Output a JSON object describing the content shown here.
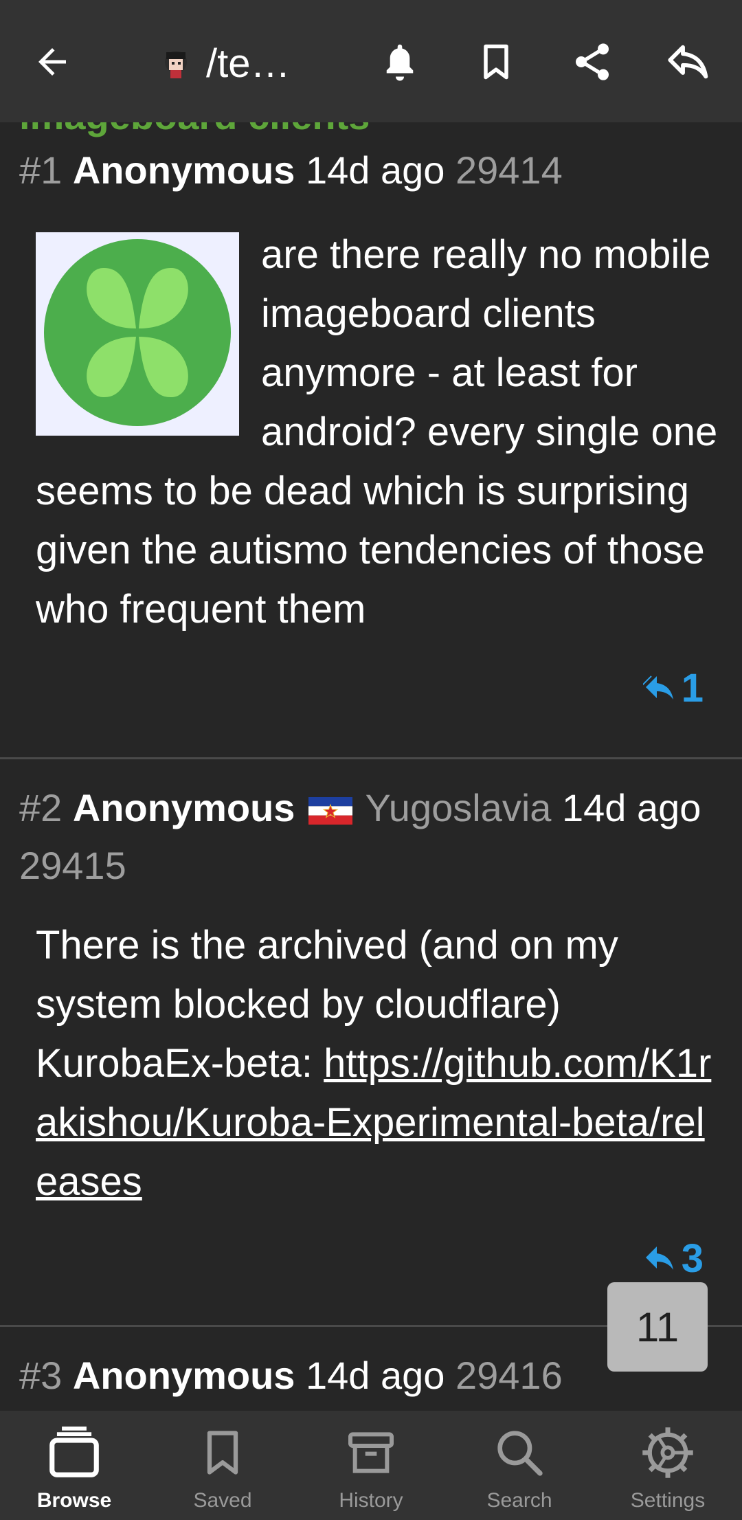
{
  "toolbar": {
    "title": "/te…",
    "icons": [
      "back-arrow-icon",
      "board-avatar-icon",
      "bell-icon",
      "bookmark-icon",
      "share-icon",
      "reply-icon"
    ]
  },
  "thread_subject": "imageboard clients",
  "posts": [
    {
      "index": "#1",
      "name": "Anonymous",
      "country": "",
      "time": "14d ago",
      "number": "29414",
      "body": "are there really no mobile imageboard clients anymore - at least for android? every single one seems to be dead which is surprising given the autismo tendencies of those who frequent them",
      "replies": "1"
    },
    {
      "index": "#2",
      "name": "Anonymous",
      "country": "Yugoslavia",
      "time": "14d",
      "time2": "ago",
      "number": "29415",
      "body": "There is the archived (and on my system blocked by cloudflare) KurobaEx-beta:",
      "link": "https://github.com/K1rakishou/Kuroba-Experimental-beta/releases",
      "replies": "3"
    },
    {
      "index": "#3",
      "name": "Anonymous",
      "time": "14d ago",
      "number": "29416"
    }
  ],
  "scroll_counter": "11",
  "bottom_nav": {
    "items": [
      {
        "label": "Browse",
        "icon": "browse-icon",
        "active": true
      },
      {
        "label": "Saved",
        "icon": "bookmark-icon",
        "active": false
      },
      {
        "label": "History",
        "icon": "archive-box-icon",
        "active": false
      },
      {
        "label": "Search",
        "icon": "search-icon",
        "active": false
      },
      {
        "label": "Settings",
        "icon": "gear-icon",
        "active": false
      }
    ]
  },
  "colors": {
    "background": "#262626",
    "toolbar": "#333333",
    "accent_blue": "#2a9de6",
    "subject_green": "#5ea63a",
    "muted_text": "#9e9e9e"
  }
}
